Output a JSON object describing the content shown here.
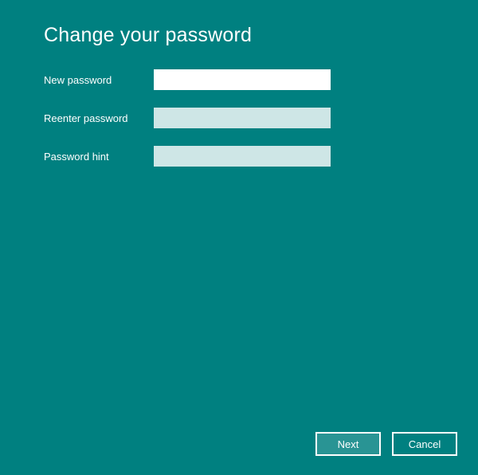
{
  "title": "Change your password",
  "fields": {
    "newPassword": {
      "label": "New password",
      "value": ""
    },
    "reenterPassword": {
      "label": "Reenter password",
      "value": ""
    },
    "passwordHint": {
      "label": "Password hint",
      "value": ""
    }
  },
  "buttons": {
    "next": "Next",
    "cancel": "Cancel"
  }
}
